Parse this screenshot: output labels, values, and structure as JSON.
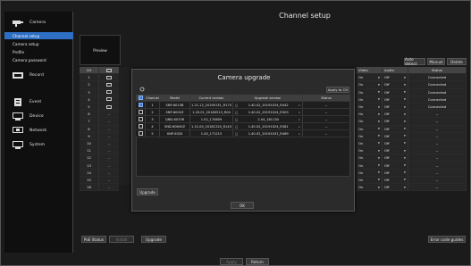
{
  "sidebar": {
    "camera_label": "Camera",
    "subitems": [
      "Channel setup",
      "Camera setup",
      "Profile",
      "Camera password"
    ],
    "active_sub": 0,
    "items": [
      "Record",
      "Event",
      "Device",
      "Network",
      "System"
    ]
  },
  "main": {
    "title": "Channel setup",
    "preview_label": "Preview",
    "buttons": {
      "auto_detect": "Auto detect",
      "manual": "Manual",
      "delete": "Delete",
      "poe_status": "PoE Status",
      "unknown_disabled": "Install",
      "upgrade": "Upgrade",
      "error_code": "Error code guides",
      "apply": "Apply",
      "return": "Return"
    },
    "left_table": {
      "headers": [
        "CH",
        "monitor"
      ],
      "rows": [
        {
          "ch": "1",
          "mon": true
        },
        {
          "ch": "2",
          "mon": true
        },
        {
          "ch": "3",
          "mon": true
        },
        {
          "ch": "4",
          "mon": true
        },
        {
          "ch": "5",
          "mon": true
        },
        {
          "ch": "6",
          "mon": false
        },
        {
          "ch": "7",
          "mon": false
        },
        {
          "ch": "8",
          "mon": false
        },
        {
          "ch": "9",
          "mon": false
        },
        {
          "ch": "10",
          "mon": false
        },
        {
          "ch": "11",
          "mon": false
        },
        {
          "ch": "12",
          "mon": false
        },
        {
          "ch": "13",
          "mon": false
        },
        {
          "ch": "14",
          "mon": false
        },
        {
          "ch": "15",
          "mon": false
        },
        {
          "ch": "16",
          "mon": false
        }
      ]
    },
    "right_table": {
      "headers": [
        "Video",
        "Audio",
        "Status"
      ],
      "rows": [
        {
          "video": "On",
          "audio": "Off",
          "status": "Connected"
        },
        {
          "video": "On",
          "audio": "Off",
          "status": "Connected"
        },
        {
          "video": "On",
          "audio": "Off",
          "status": "Connected"
        },
        {
          "video": "On",
          "audio": "Off",
          "status": "Connected"
        },
        {
          "video": "On",
          "audio": "Off",
          "status": "Connected"
        },
        {
          "video": "On",
          "audio": "Off",
          "status": "--"
        },
        {
          "video": "On",
          "audio": "Off",
          "status": "--"
        },
        {
          "video": "On",
          "audio": "Off",
          "status": "--"
        },
        {
          "video": "On",
          "audio": "Off",
          "status": "--"
        },
        {
          "video": "On",
          "audio": "Off",
          "status": "--"
        },
        {
          "video": "On",
          "audio": "Off",
          "status": "--"
        },
        {
          "video": "On",
          "audio": "Off",
          "status": "--"
        },
        {
          "video": "On",
          "audio": "Off",
          "status": "--"
        },
        {
          "video": "On",
          "audio": "Off",
          "status": "--"
        },
        {
          "video": "On",
          "audio": "Off",
          "status": "--"
        },
        {
          "video": "On",
          "audio": "Off",
          "status": "--"
        }
      ]
    }
  },
  "dialog": {
    "title": "Camera upgrade",
    "apply_to_ch": "Apply to CH",
    "headers": [
      "Channel",
      "Model",
      "Current version",
      "Upgrade version",
      "Status"
    ],
    "rows": [
      {
        "checked": true,
        "channel": "1",
        "model": "SNP-6010B",
        "current": "1.21.12_20190131_R170",
        "upgrade": "1.40.02_20191024_R442",
        "status": "--"
      },
      {
        "checked": false,
        "channel": "2",
        "model": "SNP-6002Z",
        "current": "1.20.01_20180513_R04",
        "upgrade": "1.40.02_20191024_R303",
        "status": "--"
      },
      {
        "checked": false,
        "channel": "3",
        "model": "QND-6070R",
        "current": "1.02_170809",
        "upgrade": "2.04_181130",
        "status": "--"
      },
      {
        "checked": false,
        "channel": "4",
        "model": "SND-6084VZ",
        "current": "1.21.00_20181224_R143",
        "upgrade": "1.40.02_20191024_R381",
        "status": "--"
      },
      {
        "checked": false,
        "channel": "5",
        "model": "XNP-6320",
        "current": "1.00_171215",
        "upgrade": "1.40.02_20191031_R469",
        "status": "--"
      }
    ],
    "upgrade_label": "Upgrade",
    "ok_label": "OK"
  }
}
